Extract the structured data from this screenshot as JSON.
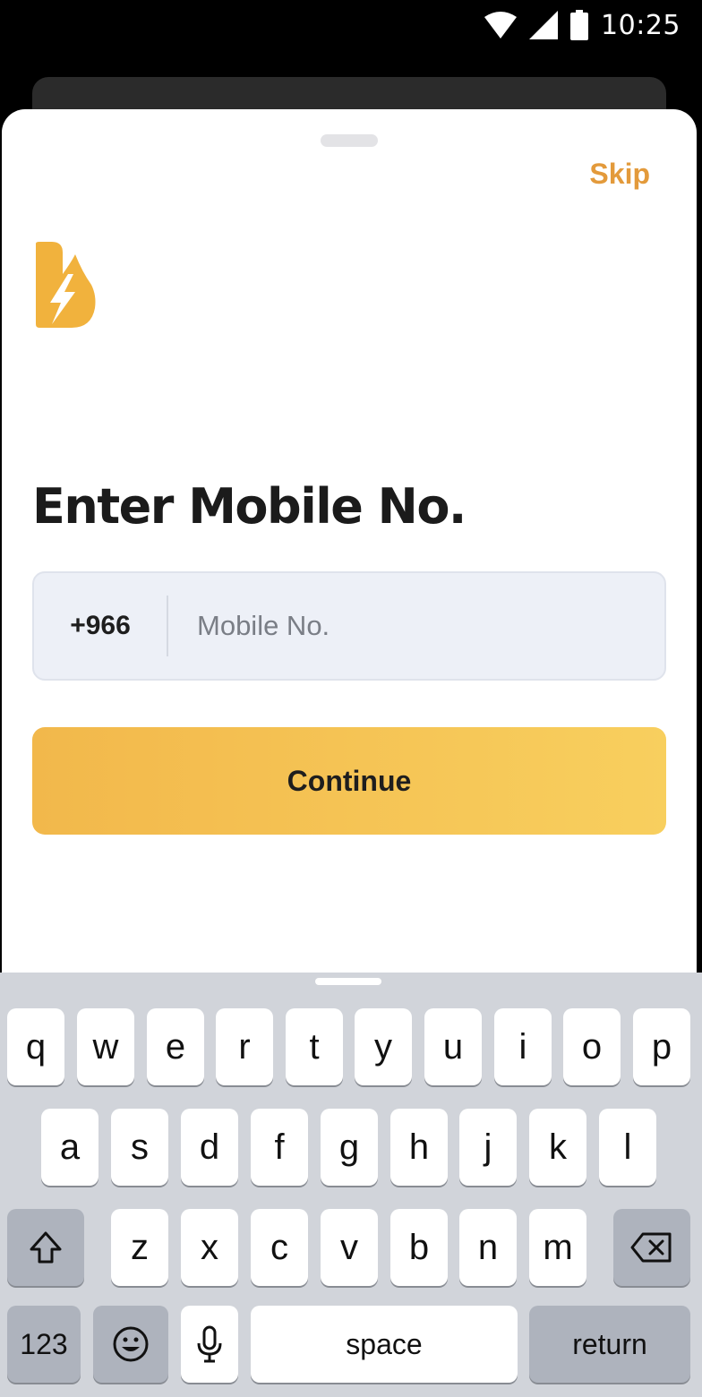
{
  "status_bar": {
    "time": "10:25"
  },
  "sheet": {
    "skip_label": "Skip",
    "heading": "Enter Mobile No.",
    "country_code": "+966",
    "mobile_placeholder": "Mobile No.",
    "continue_label": "Continue"
  },
  "colors": {
    "accent": "#e39a3b",
    "button_start": "#f2b84b",
    "button_end": "#f8cf5e",
    "input_bg": "#edf0f7"
  },
  "keyboard": {
    "row1": [
      "q",
      "w",
      "e",
      "r",
      "t",
      "y",
      "u",
      "i",
      "o",
      "p"
    ],
    "row2": [
      "a",
      "s",
      "d",
      "f",
      "g",
      "h",
      "j",
      "k",
      "l"
    ],
    "row3": [
      "z",
      "x",
      "c",
      "v",
      "b",
      "n",
      "m"
    ],
    "numbers_label": "123",
    "space_label": "space",
    "return_label": "return",
    "icons": [
      "shift-icon",
      "backspace-icon",
      "emoji-icon",
      "microphone-icon"
    ]
  }
}
